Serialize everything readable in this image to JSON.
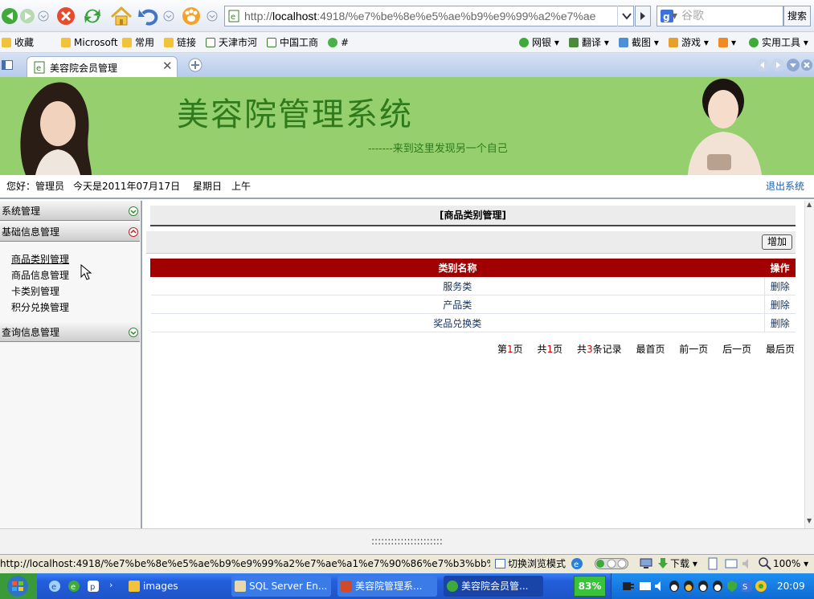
{
  "browser": {
    "address_host": "localhost",
    "address_pre": "http://",
    "address_post": ":4918/%e7%be%8e%e5%ae%b9%e9%99%a2%e7%ae",
    "search_placeholder": "谷歌",
    "search_button": "搜索"
  },
  "favorites": {
    "label": "收藏",
    "items": [
      "Microsoft",
      "常用",
      "链接",
      "天津市河",
      "中国工商",
      "#"
    ],
    "right_items": [
      "网银",
      "翻译",
      "截图",
      "游戏",
      "实用工具"
    ]
  },
  "tab": {
    "title": "美容院会员管理"
  },
  "banner": {
    "title": "美容院管理系统",
    "slogan": "-------来到这里发现另一个自己"
  },
  "greeting": {
    "hello": "您好：管理员",
    "date": "今天是2011年07月17日",
    "weekday": "星期日",
    "period": "上午",
    "logout": "退出系统"
  },
  "sidebar": {
    "menus": [
      {
        "label": "系统管理"
      },
      {
        "label": "基础信息管理",
        "items": [
          "商品类别管理",
          "商品信息管理",
          "卡类别管理",
          "积分兑换管理"
        ]
      },
      {
        "label": "查询信息管理"
      }
    ]
  },
  "main": {
    "title": "[商品类别管理]",
    "add_button": "增加",
    "columns": [
      "类别名称",
      "操作"
    ],
    "rows": [
      {
        "name": "服务类",
        "op": "删除"
      },
      {
        "name": "产品类",
        "op": "删除"
      },
      {
        "name": "奖品兑换类",
        "op": "删除"
      }
    ],
    "pager": {
      "page_pre": "第",
      "page": "1",
      "page_suf": "页",
      "total_pre": "共",
      "total": "1",
      "total_suf": "页",
      "rec_pre": "共",
      "records": "3",
      "rec_suf": "条记录",
      "first": "最首页",
      "prev": "前一页",
      "next": "后一页",
      "last": "最后页"
    }
  },
  "splitter": "::::::::::::::::::::::",
  "statusbar": {
    "url": "http://localhost:4918/%e7%be%8e%e5%ae%b9%e9%99%a2%e7%ae%a1%e7%90%86%e7%b3%bb%...",
    "mode": "切换浏览模式",
    "download": "下载",
    "zoom": "100%"
  },
  "taskbar": {
    "tasks": [
      "images",
      "SQL Server En...",
      "美容院管理系...",
      "美容院会员管..."
    ],
    "battery": "83%",
    "clock": "20:09"
  },
  "colors": {
    "banner_bg": "#95cf6e",
    "header_red": "#a00000",
    "accent_blue": "#1f5fa8"
  }
}
